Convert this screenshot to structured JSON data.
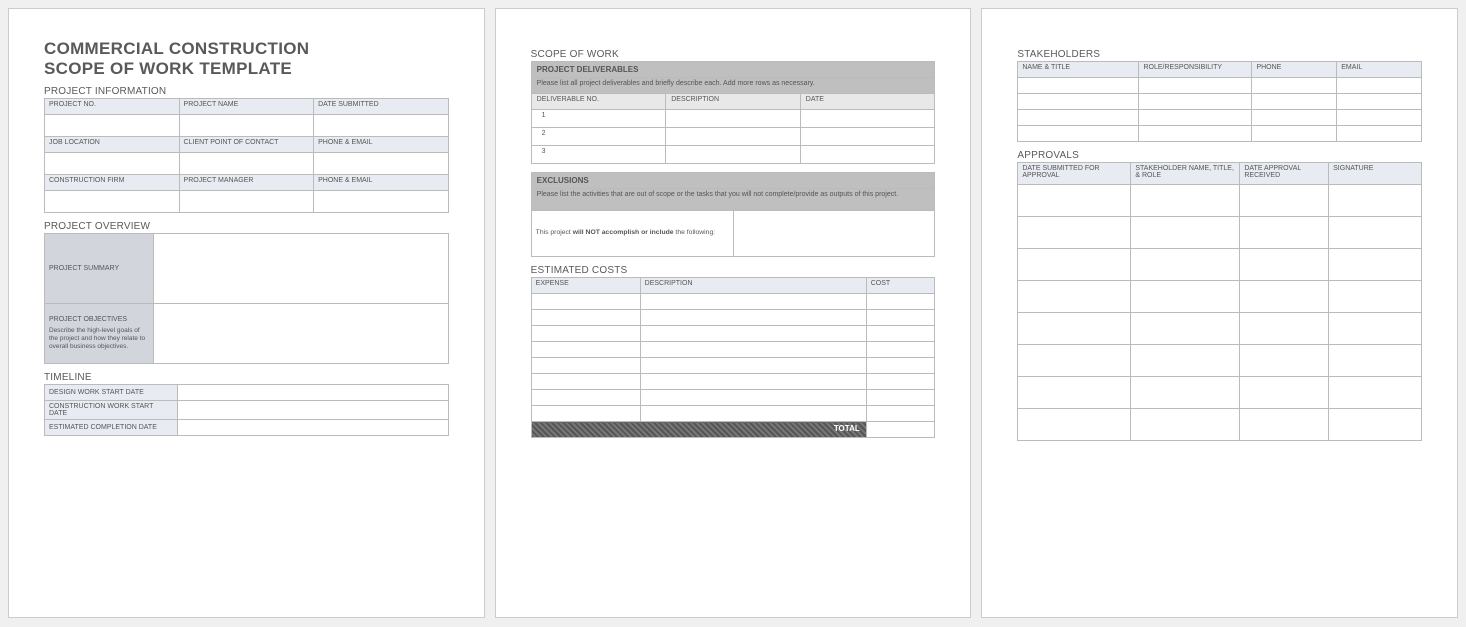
{
  "page1": {
    "title_line1": "COMMERCIAL CONSTRUCTION",
    "title_line2": "SCOPE OF WORK TEMPLATE",
    "project_info_heading": "PROJECT INFORMATION",
    "info": {
      "row1": [
        "PROJECT NO.",
        "PROJECT NAME",
        "DATE SUBMITTED"
      ],
      "row2": [
        "JOB LOCATION",
        "CLIENT POINT OF CONTACT",
        "PHONE & EMAIL"
      ],
      "row3": [
        "CONSTRUCTION FIRM",
        "PROJECT MANAGER",
        "PHONE & EMAIL"
      ]
    },
    "overview_heading": "PROJECT OVERVIEW",
    "summary_label": "PROJECT SUMMARY",
    "objectives_label": "PROJECT OBJECTIVES",
    "objectives_desc": "Describe the high-level goals of the project and how they relate to overall business objectives.",
    "timeline_heading": "TIMELINE",
    "timeline": {
      "r1": "DESIGN WORK START DATE",
      "r2": "CONSTRUCTION WORK START DATE",
      "r3": "ESTIMATED COMPLETION DATE"
    }
  },
  "page2": {
    "scope_heading": "SCOPE OF WORK",
    "deliv_band": "PROJECT DELIVERABLES",
    "deliv_instr": "Please list all project deliverables and briefly describe each. Add more rows as necessary.",
    "deliv_cols": [
      "DELIVERABLE NO.",
      "DESCRIPTION",
      "DATE"
    ],
    "deliv_rows": [
      "1",
      "2",
      "3"
    ],
    "excl_band": "EXCLUSIONS",
    "excl_instr": "Please list the activities that are out of scope or the tasks that you will not complete/provide as outputs of this project.",
    "excl_label_1": "This project ",
    "excl_label_bold": "will NOT accomplish or include",
    "excl_label_2": " the following:",
    "costs_heading": "ESTIMATED COSTS",
    "costs_cols": [
      "EXPENSE",
      "DESCRIPTION",
      "COST"
    ],
    "total_label": "TOTAL"
  },
  "page3": {
    "stake_heading": "STAKEHOLDERS",
    "stake_cols": [
      "NAME & TITLE",
      "ROLE/RESPONSIBILITY",
      "PHONE",
      "EMAIL"
    ],
    "appr_heading": "APPROVALS",
    "appr_cols": [
      "DATE SUBMITTED FOR APPROVAL",
      "STAKEHOLDER NAME, TITLE, & ROLE",
      "DATE APPROVAL RECEIVED",
      "SIGNATURE"
    ]
  }
}
